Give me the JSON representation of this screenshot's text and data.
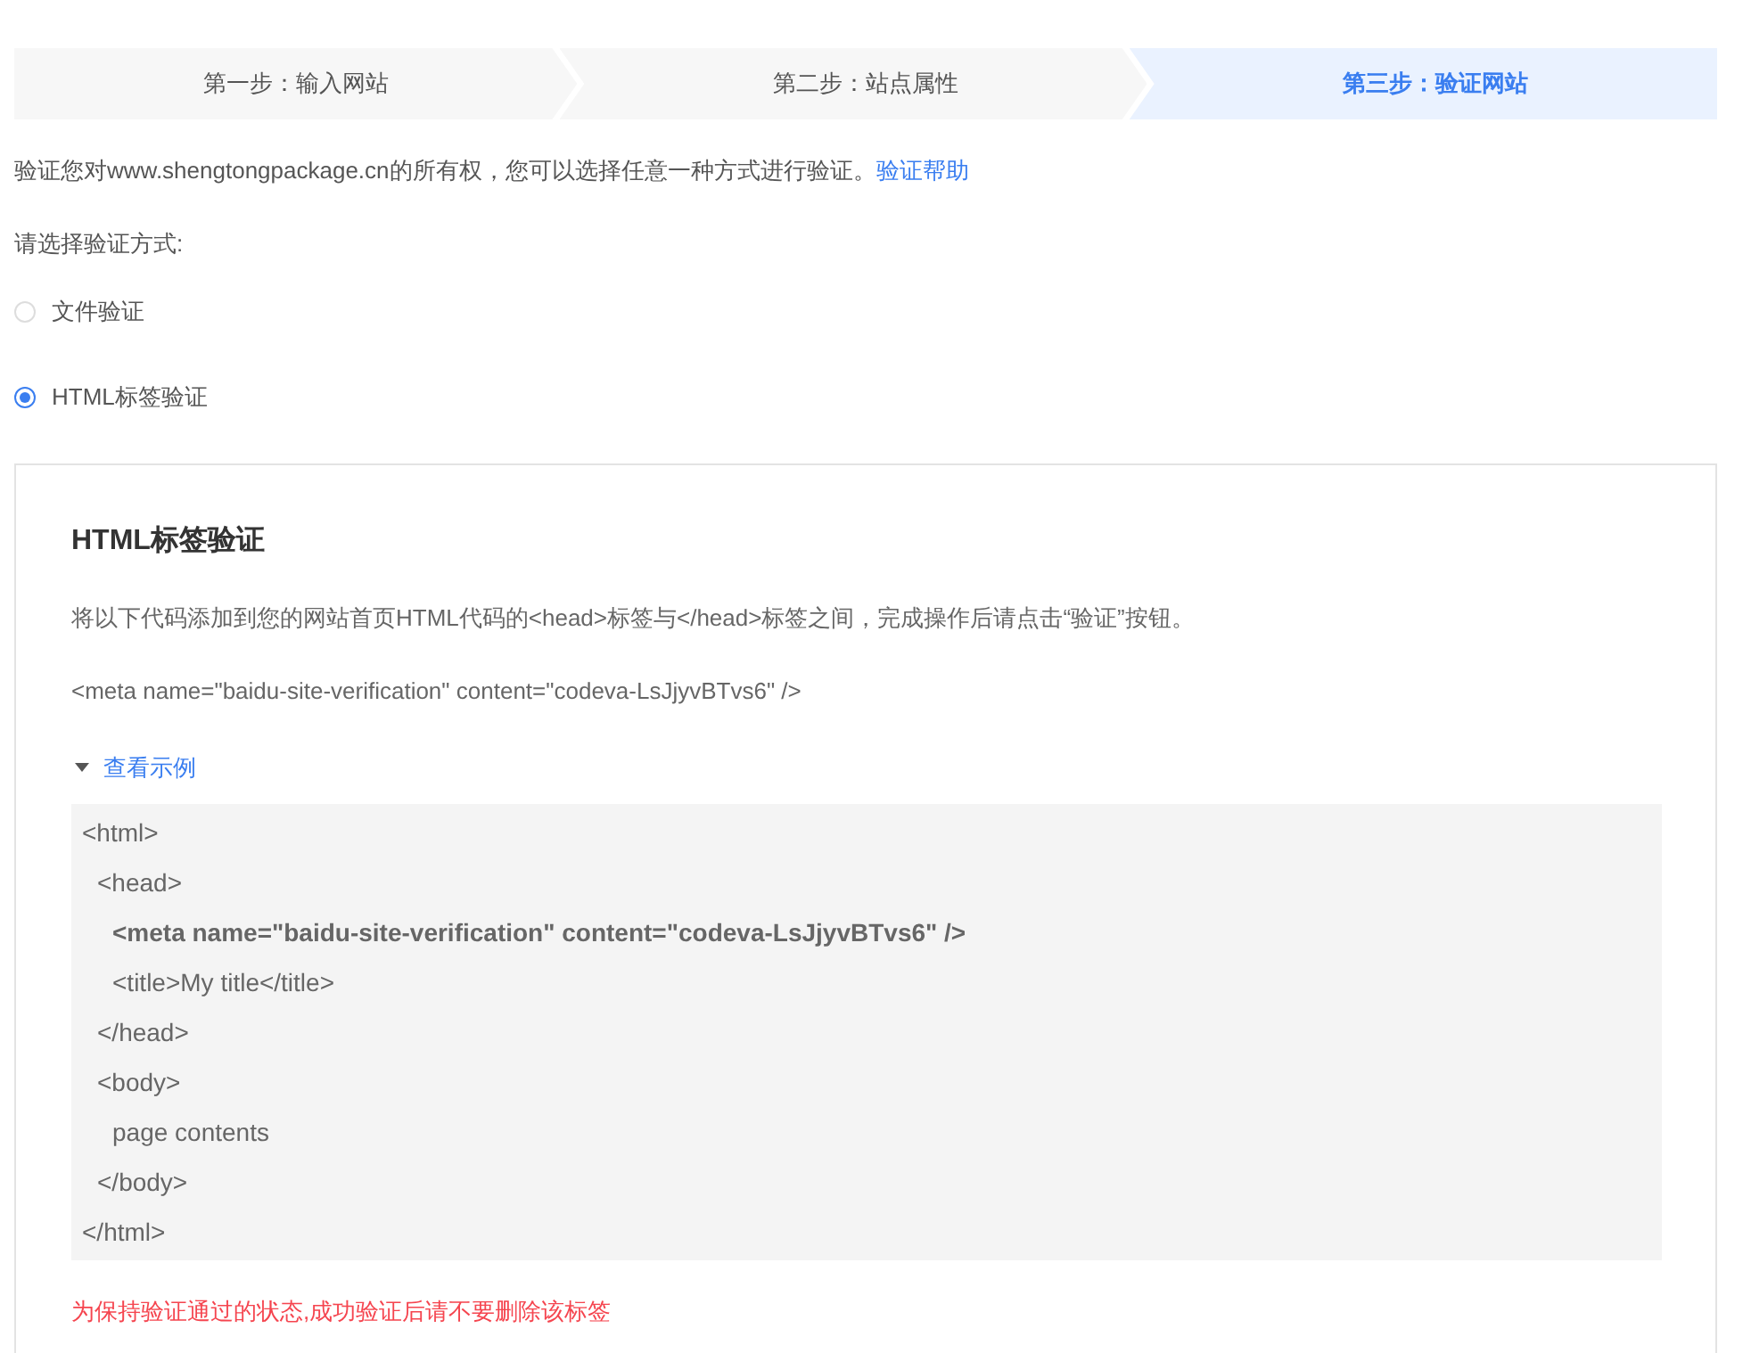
{
  "steps": [
    {
      "label": "第一步：输入网站",
      "selected": false
    },
    {
      "label": "第二步：站点属性",
      "selected": false
    },
    {
      "label": "第三步：验证网站",
      "selected": true
    }
  ],
  "intro": {
    "text": "验证您对www.shengtongpackage.cn的所有权，您可以选择任意一种方式进行验证。",
    "link": "验证帮助"
  },
  "method_prompt": "请选择验证方式:",
  "methods": [
    {
      "label": "文件验证",
      "selected": false
    },
    {
      "label": "HTML标签验证",
      "selected": true
    }
  ],
  "panel": {
    "title": "HTML标签验证",
    "instruction": "将以下代码添加到您的网站首页HTML代码的<head>标签与</head>标签之间，完成操作后请点击“验证”按钮。",
    "meta_tag": "<meta name=\"baidu-site-verification\" content=\"codeva-LsJjyvBTvs6\" />",
    "example_toggle": {
      "label": "查看示例",
      "expanded": true
    },
    "example_code": [
      {
        "text": "<html>",
        "bold": false,
        "children": [
          {
            "text": "<head>",
            "bold": false,
            "children": [
              {
                "text": "<meta name=\"baidu-site-verification\" content=\"codeva-LsJjyvBTvs6\" />",
                "bold": true
              },
              {
                "text": "<title>My title</title>",
                "bold": false
              }
            ]
          },
          {
            "text": "</head>",
            "bold": false
          },
          {
            "text": "<body>",
            "bold": false,
            "children": [
              {
                "text": "page contents",
                "bold": false
              }
            ]
          },
          {
            "text": "</body>",
            "bold": false
          }
        ]
      },
      {
        "text": "</html>",
        "bold": false
      }
    ],
    "warning": "为保持验证通过的状态,成功验证后请不要删除该标签"
  }
}
